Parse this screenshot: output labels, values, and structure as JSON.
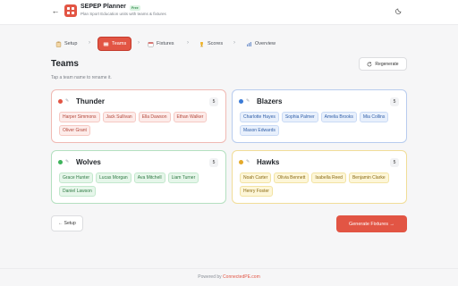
{
  "header": {
    "title": "SEPEP Planner",
    "badge": "Free",
    "subtitle": "Plan Sport Education units with teams & fixtures",
    "back_icon": "arrow-left-icon",
    "theme_icon": "moon-icon"
  },
  "steps": [
    {
      "label": "Setup",
      "icon": "clipboard-icon",
      "active": false
    },
    {
      "label": "Teams",
      "icon": "teams-icon",
      "active": true
    },
    {
      "label": "Fixtures",
      "icon": "calendar-icon",
      "active": false
    },
    {
      "label": "Scores",
      "icon": "trophy-icon",
      "active": false
    },
    {
      "label": "Overview",
      "icon": "chart-icon",
      "active": false
    }
  ],
  "section": {
    "title": "Teams",
    "hint": "Tap a team name to rename it.",
    "regenerate_label": "Regenerate"
  },
  "teams": [
    {
      "name": "Thunder",
      "count": "5",
      "color": "#e25544",
      "players": [
        "Harper Simmons",
        "Jack Sullivan",
        "Ella Dawson",
        "Ethan Walker",
        "Oliver Grant"
      ]
    },
    {
      "name": "Blazers",
      "count": "5",
      "color": "#3b7bd6",
      "players": [
        "Charlotte Hayes",
        "Sophia Palmer",
        "Amelia Brooks",
        "Mia Collins",
        "Mason Edwards"
      ]
    },
    {
      "name": "Wolves",
      "count": "5",
      "color": "#3db35b",
      "players": [
        "Grace Hunter",
        "Lucas Morgan",
        "Ava Mitchell",
        "Liam Turner",
        "Daniel Lawson"
      ]
    },
    {
      "name": "Hawks",
      "count": "5",
      "color": "#e3a92a",
      "players": [
        "Noah Carter",
        "Olivia Bennett",
        "Isabella Reed",
        "Benjamin Clarke",
        "Henry Foster"
      ]
    }
  ],
  "actions": {
    "back_label": "← Setup",
    "next_label": "Generate Fixtures →"
  },
  "footer": {
    "prefix": "Powered by",
    "link": "ConnectedPE.com"
  },
  "colors": {
    "accent": "#e25544",
    "background": "#f6f6f7"
  }
}
